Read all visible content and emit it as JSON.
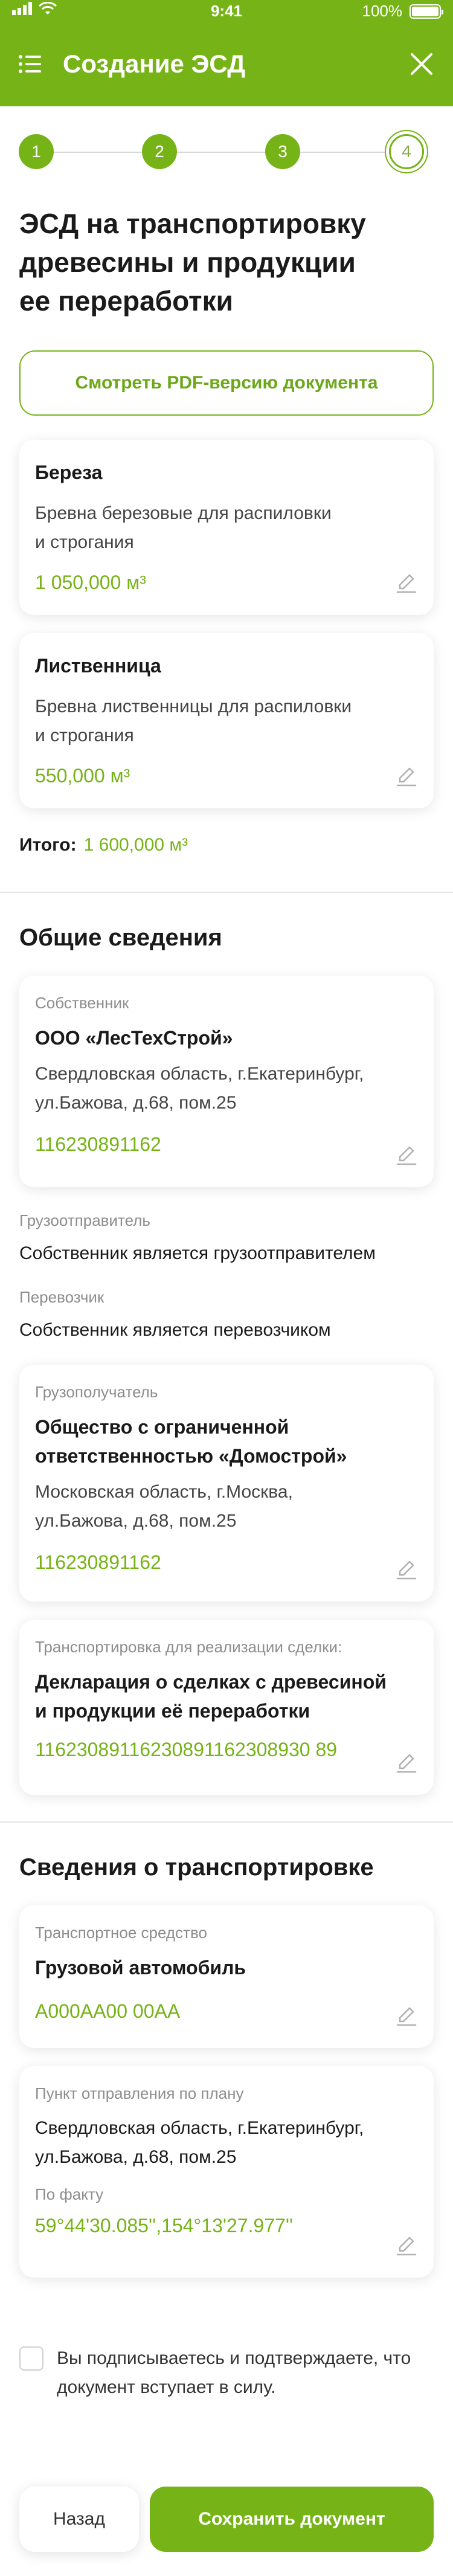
{
  "status_bar": {
    "time": "9:41",
    "battery": "100%"
  },
  "appbar": {
    "title": "Создание ЭСД"
  },
  "stepper": [
    "1",
    "2",
    "3",
    "4"
  ],
  "page_title_lines": [
    "ЭСД на транспортировку",
    "древесины и продукции",
    "ее переработки"
  ],
  "pdf_button": "Смотреть PDF-версию документа",
  "products": [
    {
      "name": "Береза",
      "desc_lines": [
        "Бревна березовые для распиловки",
        "и строгания"
      ],
      "volume": "1 050,000 м³"
    },
    {
      "name": "Лиственница",
      "desc_lines": [
        "Бревна лиственницы для распиловки",
        "и строгания"
      ],
      "volume": "550,000 м³"
    }
  ],
  "total": {
    "label": "Итого:",
    "value": "1 600,000 м³"
  },
  "general": {
    "title": "Общие сведения",
    "owner": {
      "label": "Собственник",
      "name": "ООО «ЛесТехСтрой»",
      "addr_lines": [
        "Свердловская область, г.Екатеринбург,",
        "ул.Бажова, д.68, пом.25"
      ],
      "inn": "116230891162"
    },
    "shipper": {
      "label": "Грузоотправитель",
      "value": "Собственник является грузоотправителем"
    },
    "carrier": {
      "label": "Перевозчик",
      "value": "Собственник является перевозчиком"
    },
    "consignee": {
      "label": "Грузополучатель",
      "name_lines": [
        "Общество с ограниченной",
        "ответственностью «Домострой»"
      ],
      "addr_lines": [
        "Московская область, г.Москва,",
        "ул.Бажова, д.68, пом.25"
      ],
      "inn": "116230891162"
    },
    "deal": {
      "label": "Транспортировка для реализации сделки:",
      "name_lines": [
        "Декларация о сделках с древесиной",
        "и продукции её переработки"
      ],
      "number": "11623089116230891162308930 89"
    }
  },
  "transport": {
    "title": "Сведения о транспортировке",
    "vehicle": {
      "label": "Транспортное средство",
      "name": "Грузовой автомобиль",
      "plate": "А000АА00 00АА"
    },
    "route": {
      "label": "Пункт отправления по плану",
      "addr_lines": [
        "Свердловская область, г.Екатеринбург,",
        "ул.Бажова, д.68, пом.25"
      ],
      "fact_label": "По факту",
      "coords": "59°44'30.085'',154°13'27.977''"
    }
  },
  "agree_lines": [
    "Вы подписываетесь и подтверждаете, что",
    "документ вступает в силу."
  ],
  "buttons": {
    "back": "Назад",
    "save": "Сохранить документ"
  },
  "colors": {
    "accent": "#76b317",
    "muted_text": "#8d8d8d"
  }
}
